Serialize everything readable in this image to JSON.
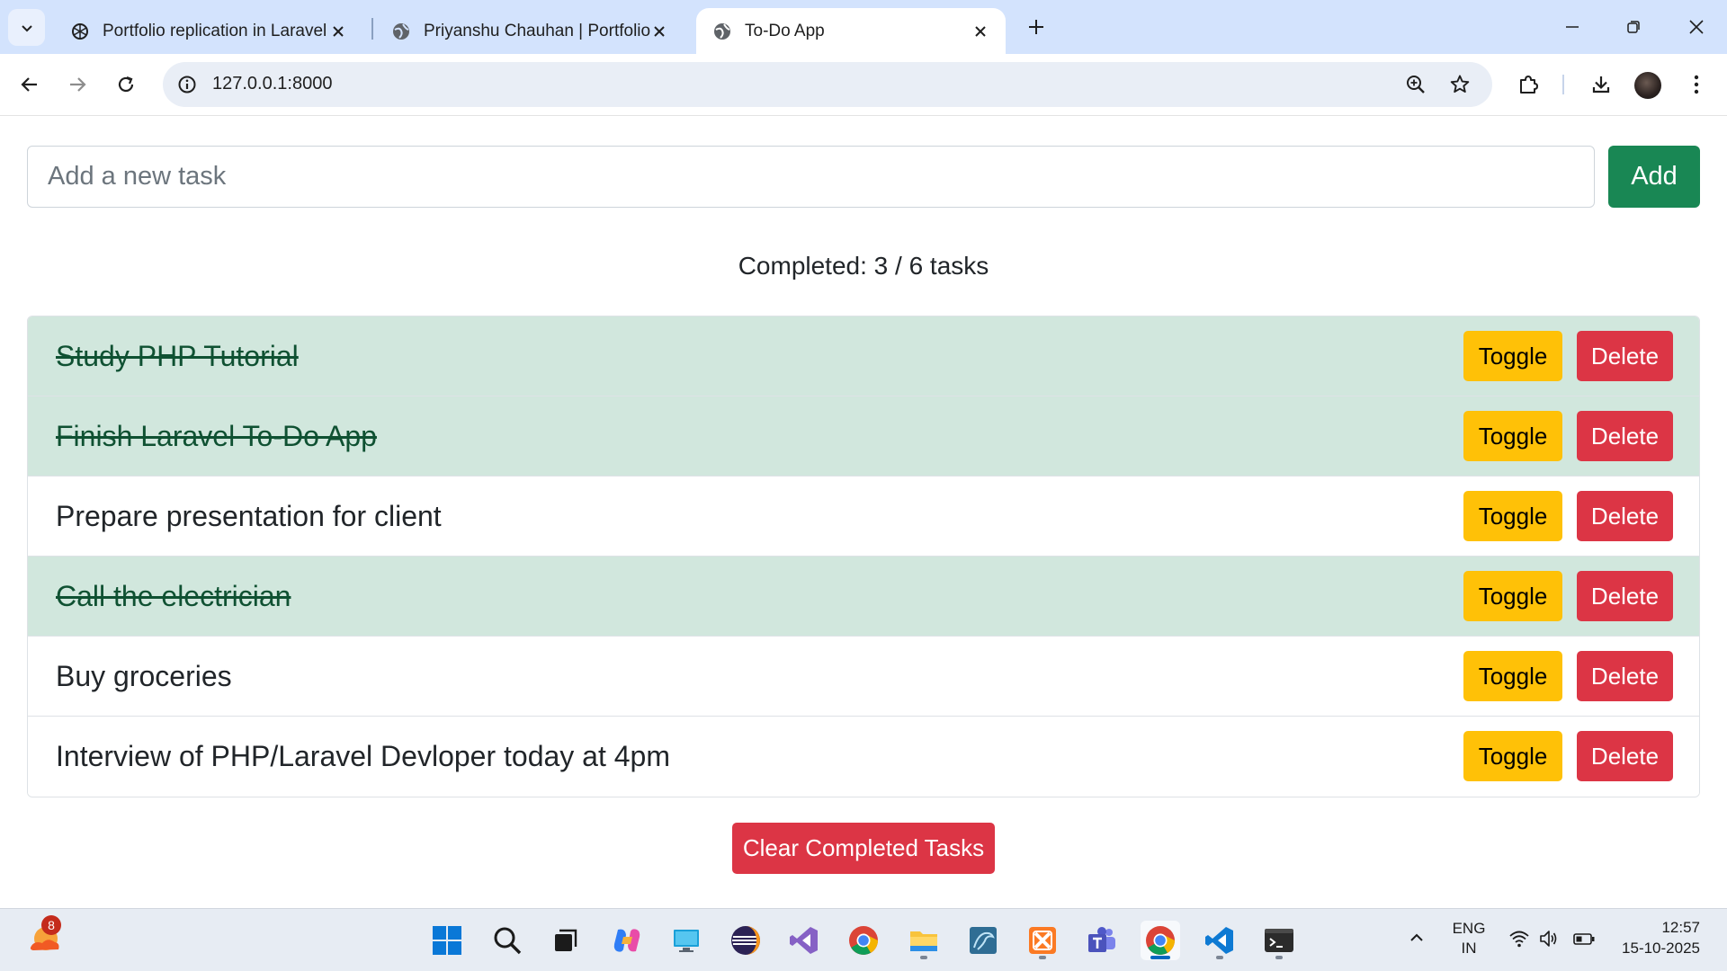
{
  "browser": {
    "tabs": [
      {
        "title": "Portfolio replication in Laravel",
        "icon": "openai-icon"
      },
      {
        "title": "Priyanshu Chauhan | Portfolio",
        "icon": "globe-icon"
      },
      {
        "title": "To-Do App",
        "icon": "globe-icon",
        "active": true
      }
    ],
    "url": "127.0.0.1:8000"
  },
  "todo": {
    "input_placeholder": "Add a new task",
    "add_label": "Add",
    "completed_text": "Completed: 3 / 6 tasks",
    "completed_count": 3,
    "total_count": 6,
    "tasks": [
      {
        "text": "Study PHP Tutorial",
        "done": true
      },
      {
        "text": "Finish Laravel To-Do App",
        "done": true
      },
      {
        "text": "Prepare presentation for client",
        "done": false
      },
      {
        "text": "Call the electrician",
        "done": true
      },
      {
        "text": "Buy groceries",
        "done": false
      },
      {
        "text": "Interview of PHP/Laravel Devloper today at 4pm",
        "done": false
      }
    ],
    "toggle_label": "Toggle",
    "delete_label": "Delete",
    "clear_label": "Clear Completed Tasks"
  },
  "colors": {
    "done_row": "#d1e7dd",
    "add_button": "#198754",
    "toggle_button": "#ffc107",
    "delete_button": "#dc3545"
  },
  "taskbar": {
    "weather_badge": "8",
    "apps": [
      "windows-start-icon",
      "search-icon",
      "task-view-icon",
      "copilot-icon",
      "remote-desktop-icon",
      "eclipse-icon",
      "visual-studio-icon",
      "chrome-icon",
      "file-explorer-icon",
      "mysql-workbench-icon",
      "xampp-icon",
      "teams-icon",
      "chrome-active-icon",
      "vscode-icon",
      "terminal-icon"
    ],
    "lang_line1": "ENG",
    "lang_line2": "IN",
    "time": "12:57",
    "date": "15-10-2025"
  }
}
